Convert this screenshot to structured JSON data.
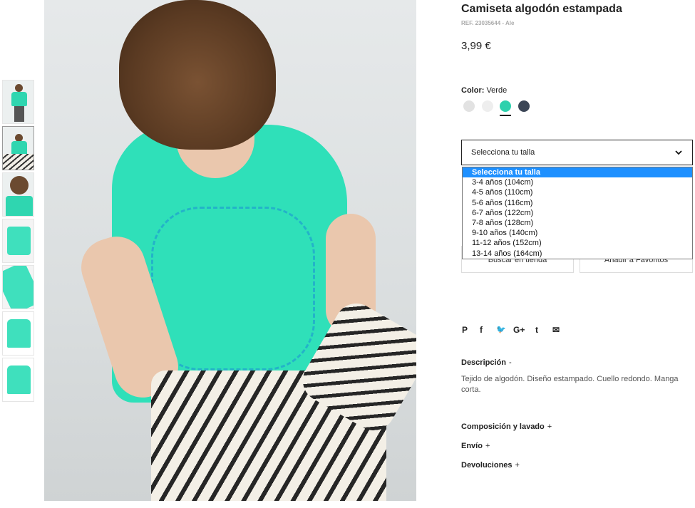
{
  "product": {
    "title": "Camiseta algodón estampada",
    "ref": "REF. 23035644 - Ale",
    "price": "3,99 €"
  },
  "color": {
    "label": "Color:",
    "value": "Verde",
    "swatches": [
      {
        "name": "gris",
        "hex": "#e2e2e2",
        "selected": false
      },
      {
        "name": "blanco",
        "hex": "#eeeeee",
        "selected": false
      },
      {
        "name": "verde",
        "hex": "#2ed1ad",
        "selected": true
      },
      {
        "name": "azul-marino",
        "hex": "#3c4656",
        "selected": false
      }
    ]
  },
  "size": {
    "placeholder": "Selecciona tu talla",
    "options": [
      "Selecciona tu talla",
      "3-4 años (104cm)",
      "4-5 años (110cm)",
      "5-6 años (116cm)",
      "6-7 años (122cm)",
      "7-8 años (128cm)",
      "9-10 años (140cm)",
      "11-12 años (152cm)",
      "13-14 años (164cm)"
    ],
    "selected_index": 0
  },
  "buttons": {
    "store": "Buscar en tienda",
    "favorites": "Añadir a Favoritos"
  },
  "social": [
    "pinterest-icon",
    "facebook-icon",
    "twitter-icon",
    "google-plus-icon",
    "tumblr-icon",
    "email-icon"
  ],
  "social_glyphs": [
    "P",
    "f",
    "🐦",
    "G+",
    "t",
    "✉"
  ],
  "description": {
    "title": "Descripción",
    "sign": "-",
    "text": "Tejido de algodón. Diseño estampado. Cuello redondo. Manga corta."
  },
  "accordions": [
    {
      "title": "Composición y lavado",
      "sign": "+"
    },
    {
      "title": "Envío",
      "sign": "+"
    },
    {
      "title": "Devoluciones",
      "sign": "+"
    }
  ]
}
